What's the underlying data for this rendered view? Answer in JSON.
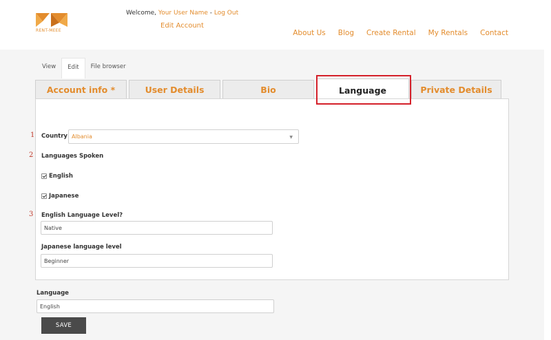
{
  "brand": {
    "logo_text": "RENT-MEEE",
    "accent_color": "#e38c2d"
  },
  "header": {
    "welcome_prefix": "Welcome, ",
    "user_name_link": "Your User Name",
    "separator": " - ",
    "logout_link": "Log Out",
    "edit_account": "Edit Account"
  },
  "nav": [
    "About Us",
    "Blog",
    "Create Rental",
    "My Rentals",
    "Contact"
  ],
  "local_tabs": [
    "View",
    "Edit",
    "File browser"
  ],
  "group_tabs": [
    "Account info *",
    "User Details",
    "Bio",
    "Language",
    "Private Details"
  ],
  "active_group_tab": "Language",
  "form": {
    "annotations": [
      "1",
      "2",
      "3"
    ],
    "country_label": "Country",
    "country_value": "Albania",
    "languages_spoken_label": "Languages Spoken",
    "languages": [
      {
        "label": "English",
        "checked": true
      },
      {
        "label": "Japanese",
        "checked": true
      }
    ],
    "english_level_label": "English Language Level?",
    "english_level_value": "Native",
    "japanese_level_label": "Japanese language level",
    "japanese_level_value": "Beginner"
  },
  "language_field": {
    "label": "Language",
    "value": "English"
  },
  "save_label": "SAVE",
  "highlight_color": "#d4202a"
}
